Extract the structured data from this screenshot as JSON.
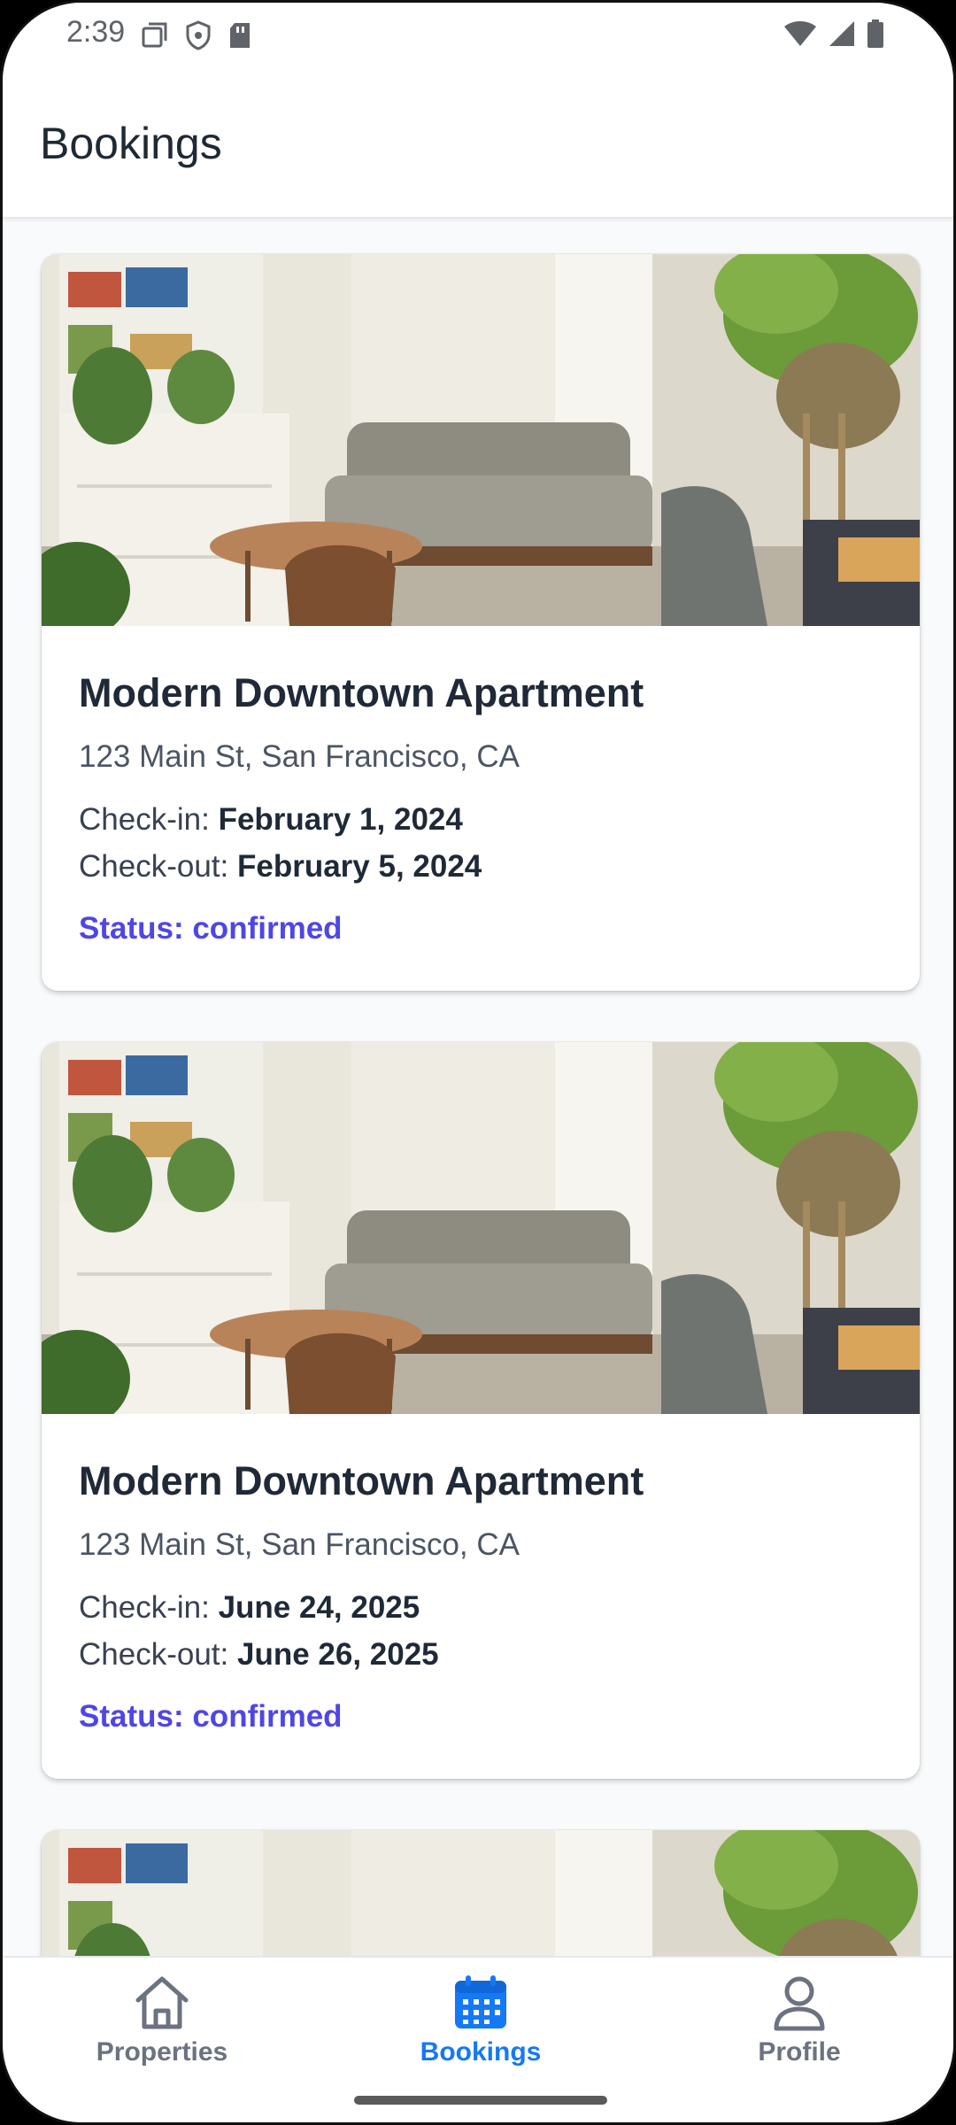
{
  "status_bar": {
    "time": "2:39"
  },
  "header": {
    "title": "Bookings"
  },
  "bookings": [
    {
      "title": "Modern Downtown Apartment",
      "address": "123 Main St, San Francisco, CA",
      "checkin_label": "Check-in:",
      "checkin": "February 1, 2024",
      "checkout_label": "Check-out:",
      "checkout": "February 5, 2024",
      "status": "Status: confirmed"
    },
    {
      "title": "Modern Downtown Apartment",
      "address": "123 Main St, San Francisco, CA",
      "checkin_label": "Check-in:",
      "checkin": "June 24, 2025",
      "checkout_label": "Check-out:",
      "checkout": "June 26, 2025",
      "status": "Status: confirmed"
    },
    {
      "title": "",
      "address": "",
      "checkin_label": "",
      "checkin": "",
      "checkout_label": "",
      "checkout": "",
      "status": ""
    }
  ],
  "nav": {
    "items": [
      {
        "label": "Properties",
        "icon": "home-icon"
      },
      {
        "label": "Bookings",
        "icon": "calendar-icon"
      },
      {
        "label": "Profile",
        "icon": "person-icon"
      }
    ],
    "active": "Bookings"
  },
  "colors": {
    "accent": "#4f46e5",
    "nav_active": "#1479f6"
  }
}
